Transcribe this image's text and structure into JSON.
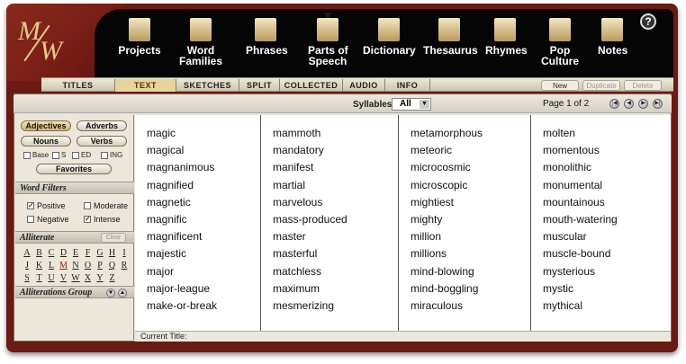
{
  "nav": {
    "items": [
      {
        "label": "Projects",
        "icon": "pen-icon"
      },
      {
        "label": "Word\nFamilies",
        "icon": "word-families-icon"
      },
      {
        "label": "Phrases",
        "icon": "phrases-icon"
      },
      {
        "label": "Parts of\nSpeech",
        "icon": "parts-of-speech-icon"
      },
      {
        "label": "Dictionary",
        "icon": "dictionary-icon"
      },
      {
        "label": "Thesaurus",
        "icon": "thesaurus-icon"
      },
      {
        "label": "Rhymes",
        "icon": "rhymes-icon"
      },
      {
        "label": "Pop\nCulture",
        "icon": "globe-icon"
      },
      {
        "label": "Notes",
        "icon": "notes-icon"
      }
    ],
    "help": "?"
  },
  "tabs": [
    "TITLES",
    "TEXT",
    "SKETCHES",
    "SPLIT",
    "COLLECTED",
    "AUDIO",
    "INFO"
  ],
  "active_tab": "TEXT",
  "tab_buttons": [
    {
      "label": "New",
      "enabled": true
    },
    {
      "label": "Duplicate",
      "enabled": false
    },
    {
      "label": "Delete",
      "enabled": false
    }
  ],
  "syllables": {
    "label": "Syllables:",
    "value": "All"
  },
  "pagination": {
    "label": "Page 1 of 2"
  },
  "pos": {
    "adjectives": "Adjectives",
    "adverbs": "Adverbs",
    "nouns": "Nouns",
    "verbs": "Verbs",
    "forms": [
      "Base",
      "S",
      "ED",
      "ING"
    ],
    "favorites": "Favorites"
  },
  "word_filters": {
    "title": "Word Filters",
    "positive": {
      "label": "Positive",
      "checked": true
    },
    "moderate": {
      "label": "Moderate",
      "checked": false
    },
    "negative": {
      "label": "Negative",
      "checked": false
    },
    "intense": {
      "label": "Intense",
      "checked": true
    }
  },
  "alliterate": {
    "title": "Alliterate",
    "clear": "Clear",
    "letters": [
      "A",
      "B",
      "C",
      "D",
      "E",
      "F",
      "G",
      "H",
      "I",
      "J",
      "K",
      "L",
      "M",
      "N",
      "O",
      "P",
      "Q",
      "R",
      "S",
      "T",
      "U",
      "V",
      "W",
      "X",
      "Y",
      "Z"
    ],
    "selected": "M"
  },
  "alliterations_group": {
    "title": "Alliterations Group"
  },
  "columns": [
    [
      "magic",
      "magical",
      "magnanimous",
      "magnified",
      "magnetic",
      "magnific",
      "magnificent",
      "majestic",
      "major",
      "major-league",
      "make-or-break"
    ],
    [
      "mammoth",
      "mandatory",
      "manifest",
      "martial",
      "marvelous",
      "mass-produced",
      "master",
      "masterful",
      "matchless",
      "maximum",
      "mesmerizing"
    ],
    [
      "metamorphous",
      "meteoric",
      "microcosmic",
      "microscopic",
      "mightiest",
      "mighty",
      "million",
      "millions",
      "mind-blowing",
      "mind-boggling",
      "miraculous"
    ],
    [
      "molten",
      "momentous",
      "monolithic",
      "monumental",
      "mountainous",
      "mouth-watering",
      "muscular",
      "muscle-bound",
      "mysterious",
      "mystic",
      "mythical"
    ]
  ],
  "status": {
    "label": "Current Title:"
  }
}
